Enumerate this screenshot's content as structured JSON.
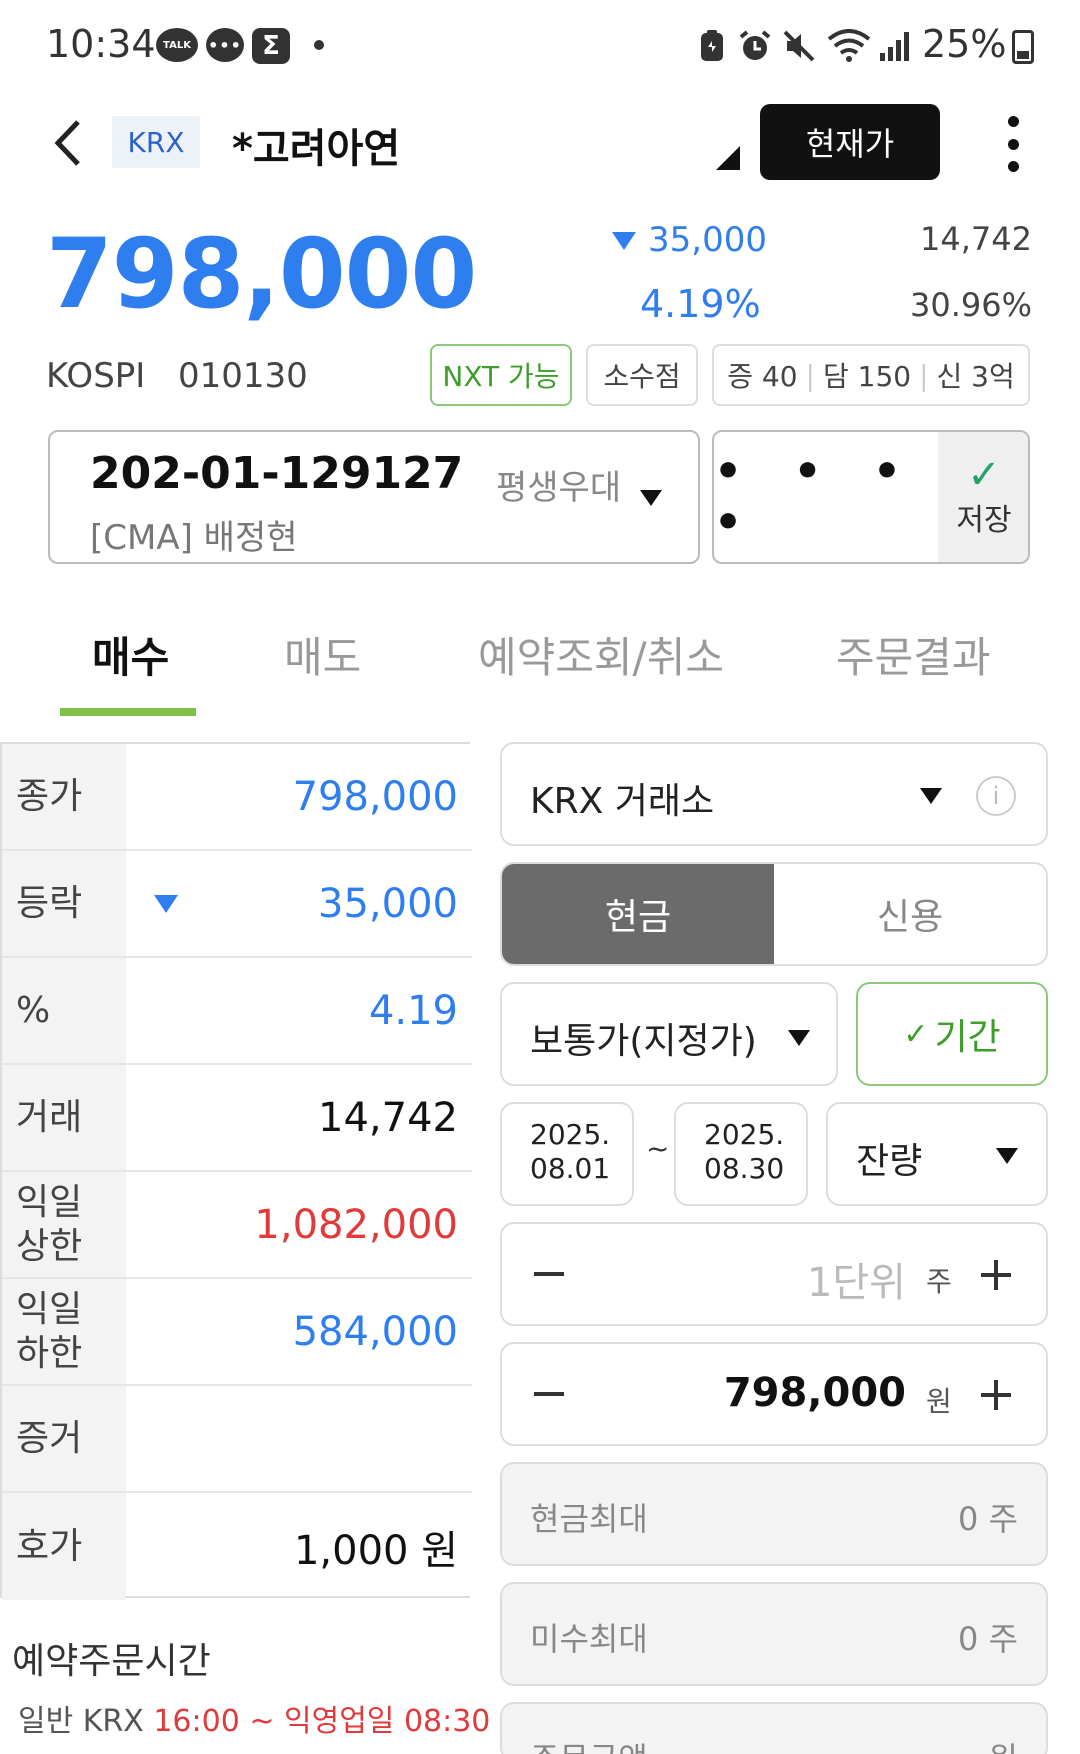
{
  "status_bar": {
    "time": "10:34",
    "battery": "25%",
    "icons": [
      "talk-icon",
      "chat-icon",
      "sigma-icon",
      "dot-icon",
      "clipboard-icon",
      "alarm-icon",
      "mute-icon",
      "wifi-icon",
      "signal-icon",
      "battery-icon"
    ],
    "talk_text": "TALK",
    "sigma_text": "Σ"
  },
  "header": {
    "exchange_badge": "KRX",
    "stock_name": "*고려아연",
    "current_price_button": "현재가"
  },
  "summary": {
    "price": "798,000",
    "change": "35,000",
    "change_rate": "4.19%",
    "volume": "14,742",
    "turnover": "30.96%",
    "market": "KOSPI",
    "code": "010130",
    "tags": {
      "nxt": "NXT 가능",
      "decimal": "소수점",
      "margin_1": "증 40",
      "margin_2": "담 150",
      "margin_3": "신 3억"
    }
  },
  "account": {
    "number": "202-01-129127",
    "name": "[CMA] 배정현",
    "grade": "평생우대",
    "password_mask": "• • • •",
    "save_label": "저장"
  },
  "tabs": [
    {
      "label": "매수",
      "active": true
    },
    {
      "label": "매도",
      "active": false
    },
    {
      "label": "예약조회/취소",
      "active": false
    },
    {
      "label": "주문결과",
      "active": false
    }
  ],
  "info_table": [
    {
      "label": "종가",
      "value": "798,000"
    },
    {
      "label": "등락",
      "value": "35,000"
    },
    {
      "label": "%",
      "value": "4.19"
    },
    {
      "label": "거래",
      "value": "14,742"
    },
    {
      "label": "익일\n상한",
      "value": "1,082,000"
    },
    {
      "label": "익일\n하한",
      "value": "584,000"
    },
    {
      "label": "증거",
      "value": ""
    },
    {
      "label": "호가",
      "value": "1,000 원"
    }
  ],
  "reserve": {
    "title": "예약주문시간",
    "prefix": "일반 KRX ",
    "range": "16:00 ~ 익영업일 08:30"
  },
  "order_form": {
    "exchange": "KRX 거래소",
    "info_icon": "i",
    "cash": "현금",
    "credit": "신용",
    "order_type": "보통가(지정가)",
    "period": "기간",
    "start_date_1": "2025.",
    "start_date_2": "08.01",
    "tilde": "~",
    "end_date_1": "2025.",
    "end_date_2": "08.30",
    "remain": "잔량",
    "qty_value": "1단위",
    "qty_unit": "주",
    "price_value": "798,000",
    "price_unit": "원",
    "cash_max_label": "현금최대",
    "cash_max_value": "0 주",
    "unpaid_max_label": "미수최대",
    "unpaid_max_value": "0 주",
    "order_amount_label": "주문금액",
    "order_amount_value": "원"
  },
  "colors": {
    "price_blue": "#2f7ef0",
    "up_red": "#e03a3a",
    "accent_green": "#7ec24c",
    "badge_blue": "#2d63c8"
  }
}
